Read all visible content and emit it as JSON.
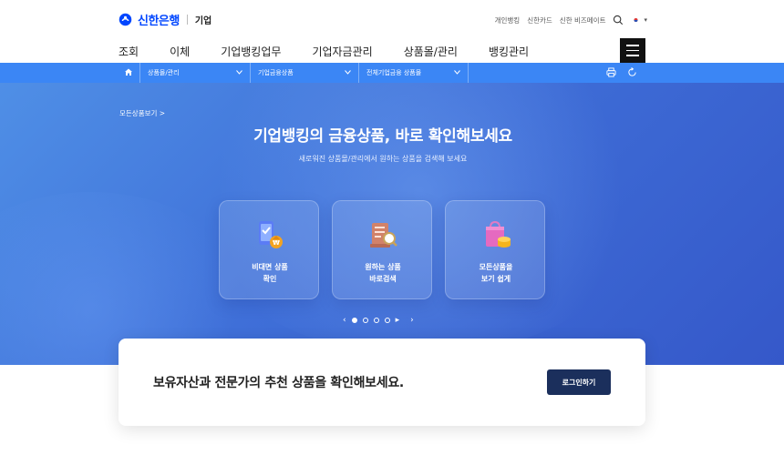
{
  "brand": {
    "name": "신한은행",
    "section": "기업",
    "color": "#0046ff"
  },
  "utility": {
    "links": [
      "개인뱅킹",
      "신한카드",
      "신한 비즈메이트"
    ],
    "search_icon": "search-icon",
    "language_icon": "korea-flag-icon"
  },
  "nav": {
    "items": [
      "조회",
      "이체",
      "기업뱅킹업무",
      "기업자금관리",
      "상품몰/관리",
      "뱅킹관리"
    ]
  },
  "breadcrumb": {
    "home_icon": "home-icon",
    "segments": [
      "상품몰/관리",
      "기업금융상품",
      "전체기업금융 상품몰"
    ],
    "tools": [
      "print-icon",
      "refresh-icon"
    ]
  },
  "hero": {
    "all_products_link": "모든상품보기 >",
    "title": "기업뱅킹의 금융상품, 바로 확인해보세요",
    "subtitle": "새로워진 상품몰/관리에서 원하는 상품을 검색해 보세요",
    "cards": [
      {
        "line1": "비대면 상품",
        "line2": "확인",
        "icon": "mobile-coin-icon"
      },
      {
        "line1": "원하는 상품",
        "line2": "바로검색",
        "icon": "document-search-icon"
      },
      {
        "line1": "모든상품을",
        "line2": "보기 쉽게",
        "icon": "shopping-bag-icon"
      }
    ],
    "pager": {
      "prev": "‹",
      "next": "›",
      "play": "▸",
      "total": 4,
      "active": 1
    }
  },
  "login_card": {
    "message": "보유자산과 전문가의 추천 상품을 확인해보세요.",
    "button": "로그인하기"
  },
  "colors": {
    "accent": "#3b86f5",
    "hero_start": "#4f8fe6",
    "hero_end": "#3558c9",
    "button": "#1b2f5c"
  }
}
